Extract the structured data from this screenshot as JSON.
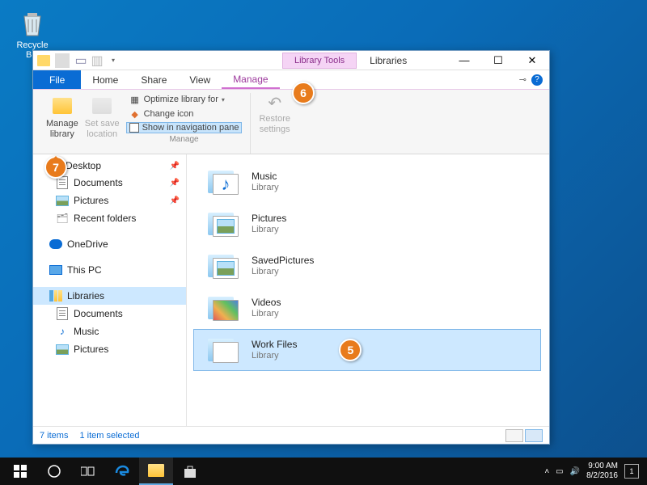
{
  "desktop": {
    "recycle_bin": "Recycle Bin"
  },
  "window": {
    "context_tab": "Library Tools",
    "title": "Libraries",
    "ctrls": {
      "min": "—",
      "max": "☐",
      "close": "✕"
    }
  },
  "tabs": {
    "file": "File",
    "home": "Home",
    "share": "Share",
    "view": "View",
    "manage": "Manage"
  },
  "ribbon": {
    "manage_library": "Manage\nlibrary",
    "set_save": "Set save\nlocation",
    "optimize": "Optimize library for",
    "change_icon": "Change icon",
    "show_nav": "Show in navigation pane",
    "restore": "Restore\nsettings",
    "group": "Manage"
  },
  "nav": {
    "desktop": "Desktop",
    "documents": "Documents",
    "pictures": "Pictures",
    "recent": "Recent folders",
    "onedrive": "OneDrive",
    "thispc": "This PC",
    "libraries": "Libraries",
    "lib_docs": "Documents",
    "lib_music": "Music",
    "lib_pics": "Pictures"
  },
  "content": {
    "type_label": "Library",
    "items": [
      {
        "name": "Music"
      },
      {
        "name": "Pictures"
      },
      {
        "name": "SavedPictures"
      },
      {
        "name": "Videos"
      },
      {
        "name": "Work Files"
      }
    ]
  },
  "status": {
    "count": "7 items",
    "selected": "1 item selected"
  },
  "callouts": {
    "c5": "5",
    "c6": "6",
    "c7": "7"
  },
  "taskbar": {
    "time": "9:00 AM",
    "date": "8/2/2016",
    "notif": "1"
  }
}
